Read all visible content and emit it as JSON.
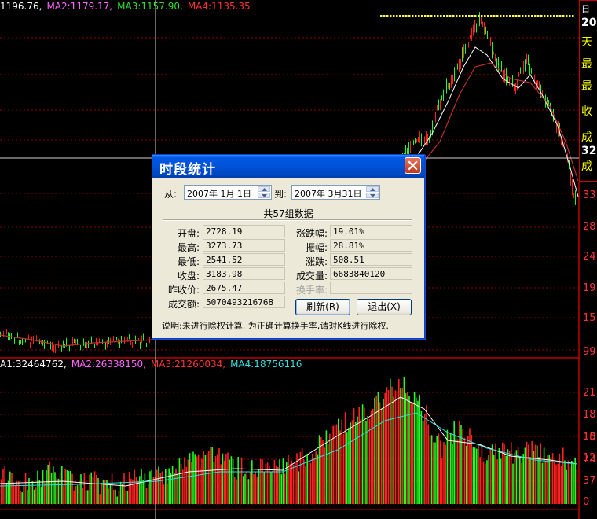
{
  "price_ma": [
    {
      "text": "1196.76,",
      "color": "#ffffff"
    },
    {
      "text": "MA2:1179.17,",
      "color": "#ff66ff"
    },
    {
      "text": "MA3:1157.90,",
      "color": "#33dd33"
    },
    {
      "text": "MA4:1135.35",
      "color": "#ff3333"
    }
  ],
  "volume_ma": [
    {
      "text": "A1:32464762,",
      "color": "#ffffff"
    },
    {
      "text": "MA2:26338150,",
      "color": "#ff66ff"
    },
    {
      "text": "MA3:21260034,",
      "color": "#ff3333"
    },
    {
      "text": "MA4:18756116",
      "color": "#33dddd"
    }
  ],
  "right_axis": {
    "price": [
      "33",
      "28",
      "24",
      "19",
      "15",
      "99"
    ],
    "volume": [
      "21",
      "18",
      "15",
      "12",
      "10",
      "73",
      "37",
      "0"
    ]
  },
  "info_panel": [
    "日",
    "20",
    "天",
    "最",
    "最",
    "收",
    "成",
    "32",
    "成"
  ],
  "dialog": {
    "title": "时段统计",
    "from_label": "从:",
    "from_value": "2007年 1月 1日",
    "to_label": "到:",
    "to_value": "2007年 3月31日",
    "count_text": "共57组数据",
    "left_fields": [
      {
        "label": "开盘:",
        "value": "2728.19"
      },
      {
        "label": "最高:",
        "value": "3273.73"
      },
      {
        "label": "最低:",
        "value": "2541.52"
      },
      {
        "label": "收盘:",
        "value": "3183.98"
      },
      {
        "label": "昨收价:",
        "value": "2675.47"
      },
      {
        "label": "成交额:",
        "value": "5070493216768"
      }
    ],
    "right_fields": [
      {
        "label": "涨跌幅:",
        "value": "19.01%",
        "disabled": false
      },
      {
        "label": "振幅:",
        "value": "28.81%",
        "disabled": false
      },
      {
        "label": "涨跌:",
        "value": "508.51",
        "disabled": false
      },
      {
        "label": "成交量:",
        "value": "6683840120",
        "disabled": false
      },
      {
        "label": "换手率:",
        "value": "",
        "disabled": true
      }
    ],
    "refresh_label": "刷新(R)",
    "exit_label": "退出(X)",
    "note": "说明:未进行除权计算, 为正确计算换手率,请对K线进行除权."
  },
  "colors": {
    "grid": "#8a0000",
    "up": "#ff2020",
    "down": "#20ff20",
    "crosshair": "#d0d0d0",
    "dialog_title": "#0054e3"
  }
}
